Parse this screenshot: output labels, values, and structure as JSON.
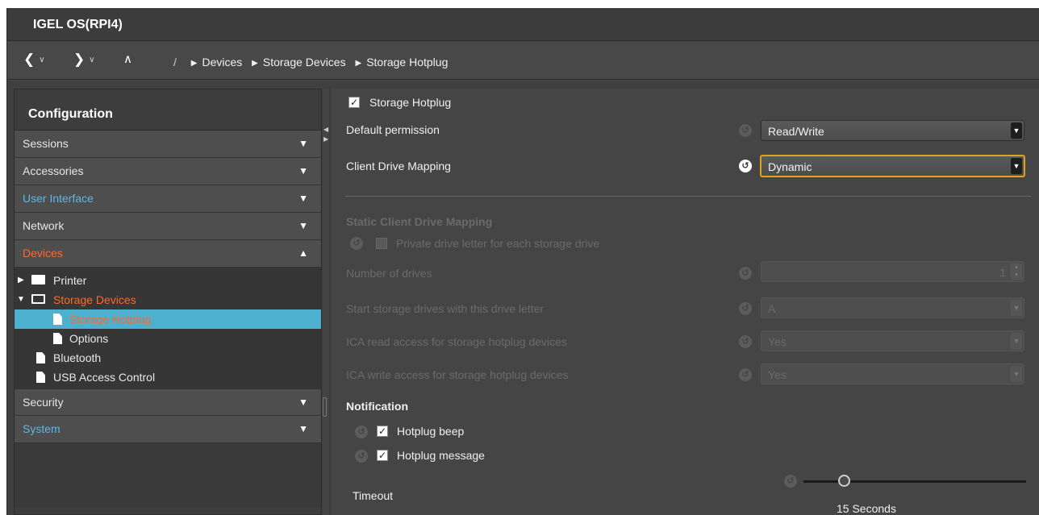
{
  "window": {
    "title": "IGEL OS(RPI4)"
  },
  "nav": {
    "back": "<",
    "forward": ">",
    "up": "^",
    "caret": "v",
    "breadcrumb": {
      "root": "/",
      "items": [
        "Devices",
        "Storage Devices",
        "Storage Hotplug"
      ]
    }
  },
  "sidebar": {
    "header": "Configuration",
    "sections": [
      {
        "label": "Sessions",
        "arrow": "▼"
      },
      {
        "label": "Accessories",
        "arrow": "▼"
      },
      {
        "label": "User Interface",
        "arrow": "▼"
      },
      {
        "label": "Network",
        "arrow": "▼"
      },
      {
        "label": "Devices",
        "arrow": "▲"
      },
      {
        "label": "Security",
        "arrow": "▼"
      },
      {
        "label": "System",
        "arrow": "▼"
      }
    ],
    "tree": [
      {
        "label": "Printer"
      },
      {
        "label": "Storage Devices"
      },
      {
        "label": "Storage Hotplug"
      },
      {
        "label": "Options"
      },
      {
        "label": "Bluetooth"
      },
      {
        "label": "USB Access Control"
      }
    ]
  },
  "main": {
    "storage_hotplug": {
      "label": "Storage Hotplug",
      "checked": "✓"
    },
    "default_permission": {
      "label": "Default permission",
      "value": "Read/Write"
    },
    "client_drive_mapping": {
      "label": "Client Drive Mapping",
      "value": "Dynamic"
    },
    "static_mapping": {
      "header": "Static Client Drive Mapping",
      "private_letter": "Private drive letter for each storage drive",
      "num_drives": {
        "label": "Number of drives",
        "value": "1"
      },
      "start_letter": {
        "label": "Start storage drives with this drive letter",
        "value": "A"
      },
      "ica_read": {
        "label": "ICA read access for storage hotplug devices",
        "value": "Yes"
      },
      "ica_write": {
        "label": "ICA write access for storage hotplug devices",
        "value": "Yes"
      }
    },
    "notification": {
      "header": "Notification",
      "beep": {
        "label": "Hotplug beep",
        "checked": "✓"
      },
      "message": {
        "label": "Hotplug message",
        "checked": "✓"
      },
      "timeout": {
        "label": "Timeout",
        "value": "15 Seconds",
        "fraction": 0.18
      }
    },
    "reset_glyph": "↺",
    "dropdown_glyph": "▼"
  }
}
